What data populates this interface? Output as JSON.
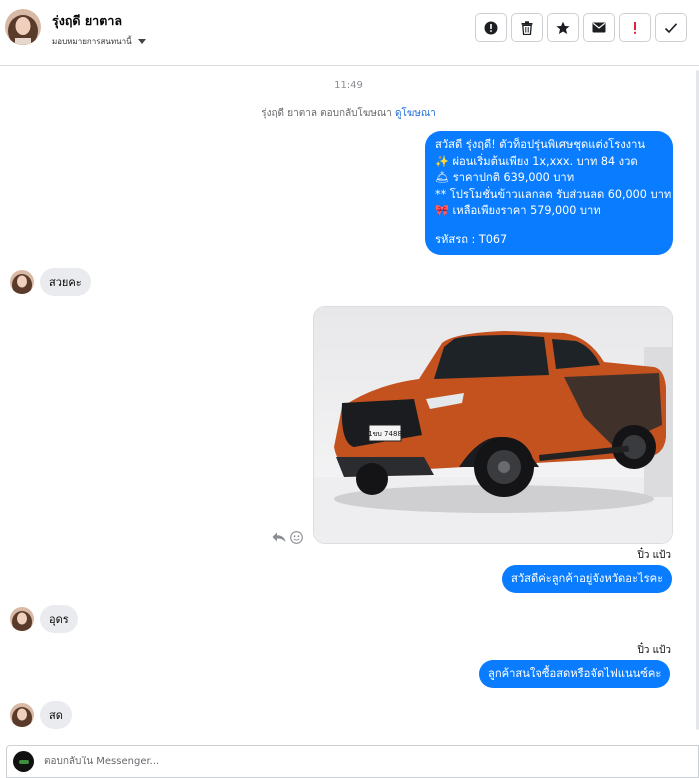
{
  "header": {
    "contact_name": "รุ่งฤดี ยาตาล",
    "assign_label": "มอบหมายการสนทนานี้",
    "actions": [
      "spam-icon",
      "trash-icon",
      "star-icon",
      "mail-icon",
      "important-icon",
      "done-icon"
    ]
  },
  "conversation": {
    "timestamp": "11:49",
    "ad_reply_text": "รุ่งฤดี ยาตาล ตอบกลับโฆษณา",
    "ad_link": "ดูโฆษณา",
    "promo_message": {
      "line1": "สวัสดี รุ่งฤดี! ตัวท็อปรุ่นพิเศษชุดแต่งโรงงาน",
      "line2": "✨  ผ่อนเริ่มต้นเพียง 1x,xxx. บาท 84 งวด",
      "line3": "🛎 ราคาปกติ 639,000 บาท",
      "line4": "** โปรโมชั่นข้าวแลกลด รับส่วนลด 60,000 บาท",
      "line5": "🎀  เหลือเพียงราคา 579,000 บาท",
      "line6": "รหัสรถ : T067"
    },
    "incoming": [
      {
        "text": "สวยคะ"
      },
      {
        "text": "อุดร"
      },
      {
        "text": "สด"
      }
    ],
    "photo": {
      "plate_text": "1ขบ 7488"
    },
    "outgoing": [
      {
        "sender": "ปิ๋ว แป้ว",
        "text": "สวัสดีค่ะลูกค้าอยู่จังหวัดอะไรคะ"
      },
      {
        "sender": "ปิ๋ว แป้ว",
        "text": "ลูกค้าสนใจซื้อสดหรือจัดไฟแนนซ์คะ"
      }
    ]
  },
  "reply": {
    "placeholder": "ตอบกลับใน Messenger..."
  },
  "colors": {
    "accent": "#0a7cff",
    "incoming_bubble": "#e9ebee",
    "link": "#216fdb"
  }
}
